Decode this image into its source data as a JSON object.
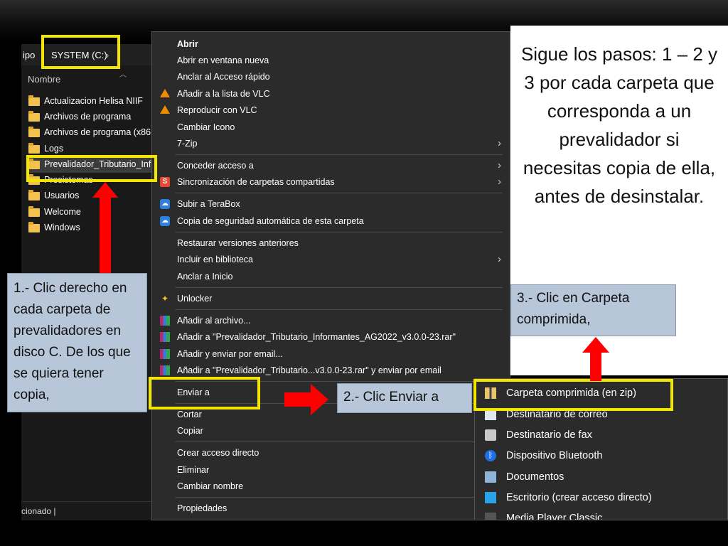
{
  "explorer": {
    "crumb_prefix": "ipo",
    "crumb_location": "SYSTEM (C:)",
    "crumb_chevron": "›",
    "column_header": "Nombre",
    "items": [
      {
        "label": "Actualizacion Helisa NIIF"
      },
      {
        "label": "Archivos de programa"
      },
      {
        "label": "Archivos de programa (x86"
      },
      {
        "label": "Logs"
      },
      {
        "label": "Prevalidador_Tributario_Inf"
      },
      {
        "label": "Presistemas"
      },
      {
        "label": "Usuarios"
      },
      {
        "label": "Welcome"
      },
      {
        "label": "Windows"
      }
    ],
    "status_text": "cionado  |"
  },
  "context_menu": {
    "items": [
      {
        "label": "Abrir"
      },
      {
        "label": "Abrir en ventana nueva"
      },
      {
        "label": "Anclar al Acceso rápido"
      },
      {
        "label": "Añadir a la lista de VLC"
      },
      {
        "label": "Reproducir con VLC"
      },
      {
        "label": "Cambiar Icono"
      },
      {
        "label": "7-Zip"
      },
      {
        "label": "Conceder acceso a"
      },
      {
        "label": "Sincronización de carpetas compartidas"
      },
      {
        "label": "Subir a TeraBox"
      },
      {
        "label": "Copia de seguridad automática de esta carpeta"
      },
      {
        "label": "Restaurar versiones anteriores"
      },
      {
        "label": "Incluir en biblioteca"
      },
      {
        "label": "Anclar a Inicio"
      },
      {
        "label": "Unlocker"
      },
      {
        "label": "Añadir al archivo..."
      },
      {
        "label": "Añadir a \"Prevalidador_Tributario_Informantes_AG2022_v3.0.0-23.rar\""
      },
      {
        "label": "Añadir y enviar por email..."
      },
      {
        "label": "Añadir a \"Prevalidador_Tributario...v3.0.0-23.rar\" y enviar por email"
      },
      {
        "label": "Enviar a"
      },
      {
        "label": "Cortar"
      },
      {
        "label": "Copiar"
      },
      {
        "label": "Crear acceso directo"
      },
      {
        "label": "Eliminar"
      },
      {
        "label": "Cambiar nombre"
      },
      {
        "label": "Propiedades"
      }
    ],
    "submenu_arrow": "›"
  },
  "send_to_menu": {
    "items": [
      {
        "label": "Carpeta comprimida (en zip)"
      },
      {
        "label": "Destinatario de correo"
      },
      {
        "label": "Destinatario de fax"
      },
      {
        "label": "Dispositivo Bluetooth"
      },
      {
        "label": "Documentos"
      },
      {
        "label": "Escritorio (crear acceso directo)"
      },
      {
        "label": "Media Player Classic"
      }
    ]
  },
  "instructions": {
    "text": "Sigue los pasos: 1 – 2 y 3 por cada carpeta que corresponda a un prevalidador si necesitas copia de ella, antes de desinstalar."
  },
  "steps": {
    "step1": "1.- Clic derecho en cada carpeta de prevalidadores en disco C. De los que se quiera tener copia,",
    "step2": "2.- Clic Enviar a",
    "step3": "3.- Clic en Carpeta comprimida,"
  },
  "colors": {
    "highlight": "#f2e600",
    "arrow": "#ff0000",
    "note_bg": "#b7c6d8",
    "menu_bg": "#2b2b2b"
  }
}
